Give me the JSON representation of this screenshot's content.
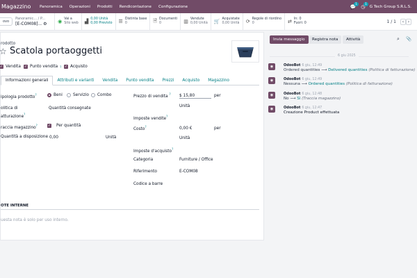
{
  "topbar": {
    "app": "Magazzino",
    "menu": [
      "Panoramica",
      "Operazioni",
      "Prodotti",
      "Rendicontazione",
      "Configurazione"
    ],
    "msg_badge": "1",
    "activity_badge": "1",
    "company": "G Tech Group S.R.L.S."
  },
  "controlbar": {
    "new_label": "ovo",
    "breadcrumb_parent": "Panoramic...",
    "breadcrumb_sep": "/",
    "breadcrumb_child": "P...",
    "record": "[E-COM08]...",
    "smart_buttons": [
      {
        "icon": "globe-icon",
        "line1": "Vai a",
        "line2": "Sito web"
      },
      {
        "icon": "chart-icon",
        "line1": "0,00 Unità",
        "line2": "0,00 Previsto"
      },
      {
        "icon": "list-icon",
        "line1": "Distinta base",
        "line2": "0"
      },
      {
        "icon": "document-icon",
        "line1": "Documenti",
        "line2": "0"
      },
      {
        "icon": "sales-icon",
        "line1": "Vendute",
        "line2": "0,00 Unità"
      },
      {
        "icon": "cart-icon",
        "line1": "Acquistate",
        "line2": "0,00 Unità"
      },
      {
        "icon": "refresh-icon",
        "line1": "Regole di riordino",
        "line2": "0"
      },
      {
        "icon": "swap-icon",
        "line1": "In: 0",
        "line2": "Fuori: 0"
      }
    ],
    "pager": "1 / 1"
  },
  "form": {
    "product_label": "rodotto",
    "product_name": "Scatola portaoggetti",
    "flags": {
      "vendita": "Vendita",
      "punto_vendita": "Punto vendita",
      "acquisto": "Acquisto",
      "q": "?"
    },
    "tabs": [
      "Informazioni generali",
      "Attributi e varianti",
      "Vendita",
      "Punto vendita",
      "Prezzi",
      "Acquisto",
      "Magazzino"
    ],
    "tipologia_label": "ipologia prodotto",
    "tipologia_options": [
      "Beni",
      "Servizio",
      "Combo"
    ],
    "politica_label_1": "olitica di",
    "politica_label_2": "atturazione",
    "politica_value": "Quantità consegnate",
    "traccia_label": "raccia magazzino",
    "traccia_value": "Per quantità",
    "qty_label": "Quantità a disposizione",
    "qty_value": "0,00",
    "qty_unit": "Unità",
    "prezzo_label": "Prezzo di vendita",
    "prezzo_value": "$ 15,80",
    "per": "per",
    "unita": "Unità",
    "imposte_vendite_label": "Imposte vendite",
    "costo_label": "Costo",
    "costo_value": "0,00 €",
    "imposte_acquisto_label": "Imposte d'acquisto",
    "categoria_label": "Categoria",
    "categoria_value": "Furniture / Office",
    "riferimento_label": "Riferimento",
    "riferimento_value": "E-COM08",
    "barcode_label": "Codice a barre",
    "note_title": "OTE INTERNE",
    "note_placeholder": "uesta nota è solo per uso interno."
  },
  "chatter": {
    "send_message": "Invia messaggio",
    "log_note": "Registra nota",
    "activity": "Attività",
    "date_sep": "6 giu 2025",
    "messages": [
      {
        "author": "OdooBot",
        "date": "6 giu, 12:49",
        "old": "Ordered quantities",
        "new": "Delivered quantities",
        "field": "(Politica di fatturazione)"
      },
      {
        "author": "OdooBot",
        "date": "6 giu, 12:49",
        "old": "Nessuna",
        "new": "Ordered quantities",
        "field": "(Politica di fatturazione)"
      },
      {
        "author": "OdooBot",
        "date": "6 giu, 12:48",
        "old": "No",
        "new": "Sì",
        "field": "(Traccia magazzino)"
      },
      {
        "author": "OdooBot",
        "date": "6 giu, 12:47",
        "text": "Creazione Product effettuata"
      }
    ]
  }
}
